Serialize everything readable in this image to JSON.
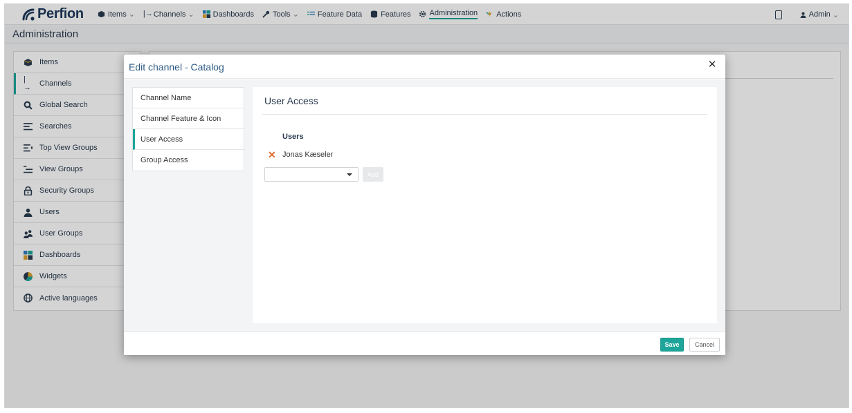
{
  "brand": {
    "name": "Perfion",
    "accent": "#1ea59a",
    "navy": "#1d3a5c"
  },
  "topnav": {
    "items": [
      {
        "label": "Items",
        "icon": "box-icon",
        "caret": true
      },
      {
        "label": "Channels",
        "icon": "channel-icon",
        "caret": true
      },
      {
        "label": "Dashboards",
        "icon": "dashboard-icon",
        "caret": false
      },
      {
        "label": "Tools",
        "icon": "wrench-icon",
        "caret": true
      },
      {
        "label": "Feature Data",
        "icon": "list-icon",
        "caret": false
      },
      {
        "label": "Features",
        "icon": "database-icon",
        "caret": false
      },
      {
        "label": "Administration",
        "icon": "gear-icon",
        "caret": false,
        "active": true
      },
      {
        "label": "Actions",
        "icon": "actions-icon",
        "caret": false
      }
    ],
    "user": {
      "label": "Admin"
    }
  },
  "page": {
    "title": "Administration"
  },
  "sidebar": {
    "items": [
      {
        "label": "Items",
        "icon": "box-icon"
      },
      {
        "label": "Channels",
        "icon": "channel-icon",
        "active": true
      },
      {
        "label": "Global Search",
        "icon": "search-icon"
      },
      {
        "label": "Searches",
        "icon": "searches-icon"
      },
      {
        "label": "Top View Groups",
        "icon": "top-view-groups-icon"
      },
      {
        "label": "View Groups",
        "icon": "view-groups-icon"
      },
      {
        "label": "Security Groups",
        "icon": "lock-icon"
      },
      {
        "label": "Users",
        "icon": "user-icon"
      },
      {
        "label": "User Groups",
        "icon": "user-group-icon"
      },
      {
        "label": "Dashboards",
        "icon": "dashboard-icon"
      },
      {
        "label": "Widgets",
        "icon": "pie-icon"
      },
      {
        "label": "Active languages",
        "icon": "globe-icon"
      }
    ]
  },
  "modal": {
    "title": "Edit channel - Catalog",
    "tabs": [
      {
        "label": "Channel Name"
      },
      {
        "label": "Channel Feature & Icon"
      },
      {
        "label": "User Access",
        "active": true
      },
      {
        "label": "Group Access"
      }
    ],
    "panel": {
      "title": "User Access",
      "users_heading": "Users",
      "users": [
        "Jonas Kæseler"
      ],
      "select_value": "",
      "add_label": "Add"
    },
    "footer": {
      "save_label": "Save",
      "cancel_label": "Cancel"
    }
  }
}
